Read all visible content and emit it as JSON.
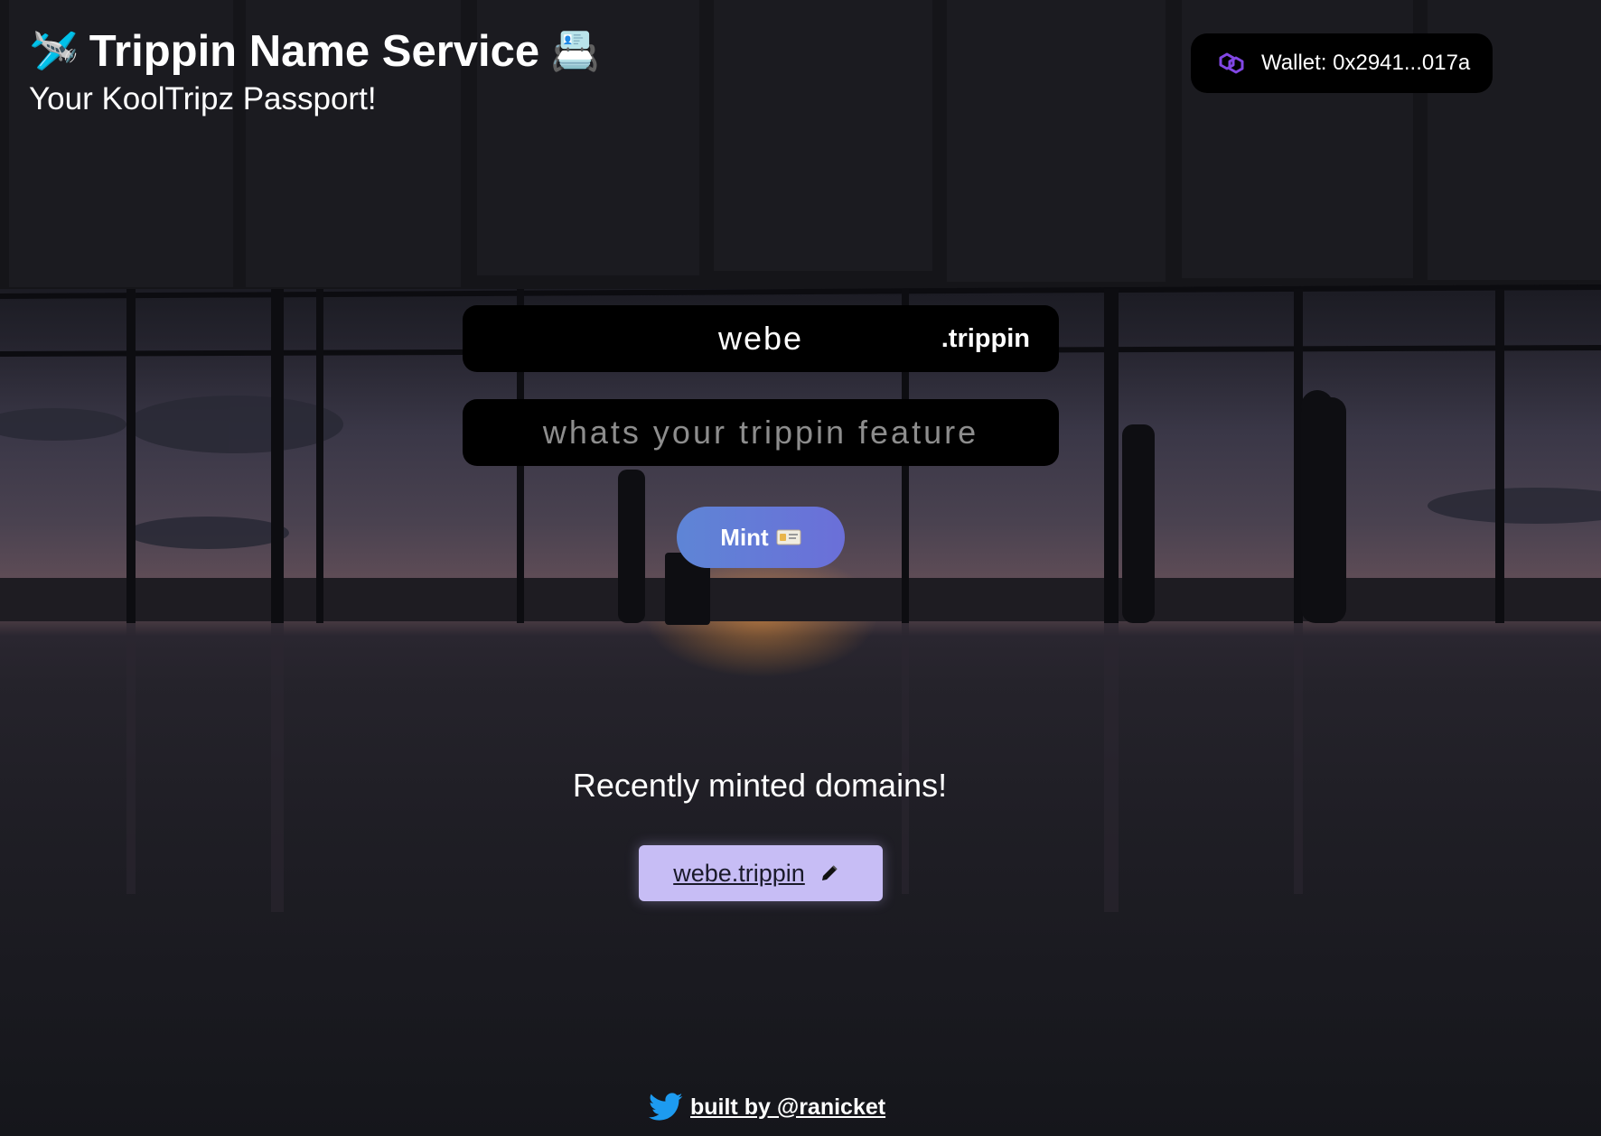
{
  "header": {
    "title_emoji_left": "🛩️",
    "title": "Trippin Name Service",
    "title_emoji_right": "📇",
    "subtitle": "Your KoolTripz Passport!"
  },
  "wallet": {
    "icon": "polygon-icon",
    "label": "Wallet: 0x2941...017a"
  },
  "form": {
    "domain_value": "webe",
    "tld": ".trippin",
    "feature_placeholder": "whats your trippin feature",
    "mint_label": "Mint",
    "mint_icon": "id-card-icon"
  },
  "recent": {
    "title": "Recently minted domains!",
    "items": [
      {
        "name": "webe.trippin",
        "edit_icon": "pencil-icon"
      }
    ]
  },
  "footer": {
    "icon": "twitter-icon",
    "link": "built by @ranicket"
  },
  "colors": {
    "mint_button": "#6b7ad7",
    "chip_background": "#c7bdf5",
    "wallet_icon": "#8247e5",
    "twitter": "#1d9bf0"
  }
}
